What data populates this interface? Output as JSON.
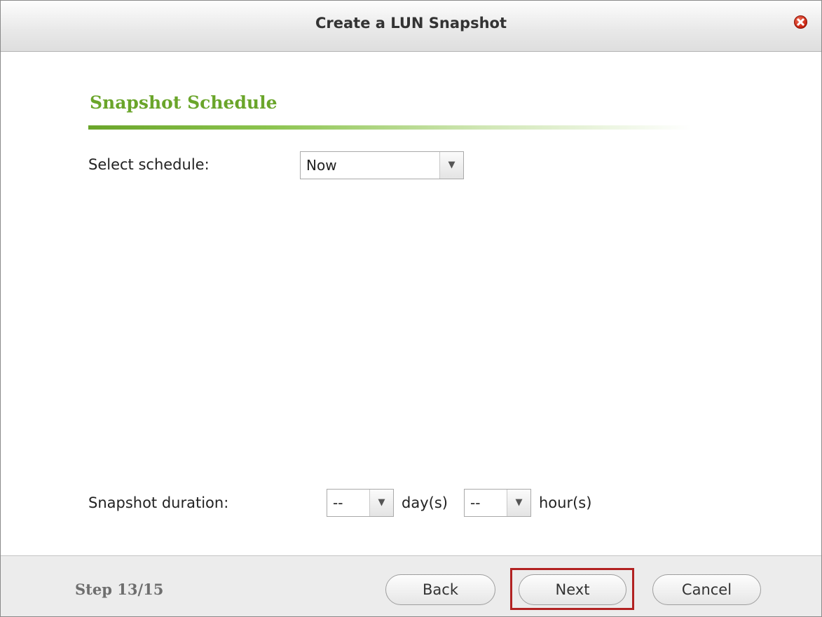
{
  "dialog": {
    "title": "Create a LUN Snapshot",
    "close_icon": "close-icon"
  },
  "section": {
    "title": "Snapshot Schedule"
  },
  "schedule": {
    "label": "Select schedule:",
    "value": "Now"
  },
  "duration": {
    "label": "Snapshot duration:",
    "days_value": "--",
    "days_unit": "day(s)",
    "hours_value": "--",
    "hours_unit": "hour(s)"
  },
  "footer": {
    "step": "Step 13/15",
    "back_label": "Back",
    "next_label": "Next",
    "cancel_label": "Cancel"
  },
  "colors": {
    "section_green": "#6aa52a",
    "highlight_red": "#b22222",
    "close_red": "#c8220f"
  },
  "icons": {
    "dropdown": "chevron-down-icon"
  }
}
